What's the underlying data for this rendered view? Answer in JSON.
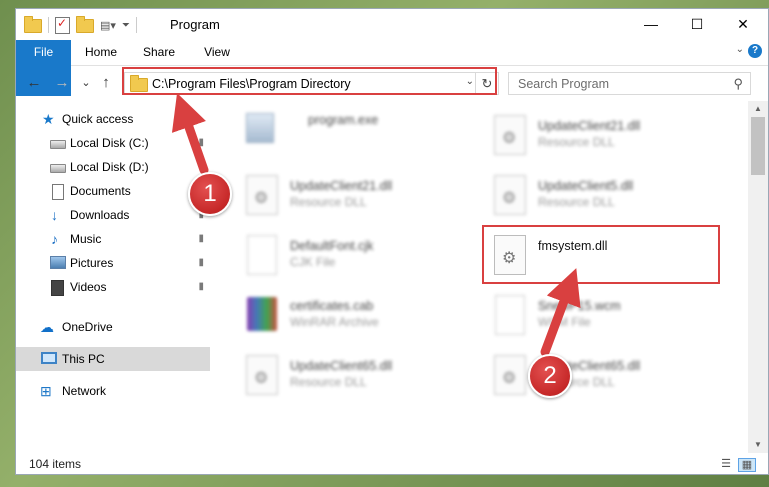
{
  "window": {
    "title": "Program",
    "minimize": "—",
    "maximize": "☐",
    "close": "✕"
  },
  "ribbon": {
    "tabs": [
      "File",
      "Home",
      "Share",
      "View"
    ]
  },
  "navigation": {
    "back": "←",
    "forward": "→",
    "recent": "⌄",
    "up": "↑",
    "address": "C:\\Program Files\\Program Directory",
    "search_placeholder": "Search Program"
  },
  "sidebar": {
    "items": [
      {
        "label": "Quick access",
        "icon": "star-icon",
        "pinned": false
      },
      {
        "label": "Local Disk (C:)",
        "icon": "drive-icon",
        "pinned": true
      },
      {
        "label": "Local Disk (D:)",
        "icon": "drive-icon",
        "pinned": false
      },
      {
        "label": "Documents",
        "icon": "documents-icon",
        "pinned": true
      },
      {
        "label": "Downloads",
        "icon": "downloads-icon",
        "pinned": true
      },
      {
        "label": "Music",
        "icon": "music-icon",
        "pinned": true
      },
      {
        "label": "Pictures",
        "icon": "pictures-icon",
        "pinned": true
      },
      {
        "label": "Videos",
        "icon": "videos-icon",
        "pinned": true
      },
      {
        "label": "OneDrive",
        "icon": "onedrive-icon",
        "pinned": false
      },
      {
        "label": "This PC",
        "icon": "this-pc-icon",
        "pinned": false,
        "selected": true
      },
      {
        "label": "Network",
        "icon": "network-icon",
        "pinned": false
      }
    ],
    "pin_glyph": "📌"
  },
  "files": [
    {
      "name": "program.exe",
      "type": "",
      "icon": "exe-icon"
    },
    {
      "name": "UpdateClient21.dll",
      "type": "Resource DLL",
      "icon": "dll-icon"
    },
    {
      "name": "UpdateClient21.dll",
      "type": "Resource DLL",
      "icon": "dll-icon"
    },
    {
      "name": "UpdateClient5.dll",
      "type": "Resource DLL",
      "icon": "dll-icon"
    },
    {
      "name": "DefaultFont.cjk",
      "type": "CJK File",
      "icon": "file-icon"
    },
    {
      "name": "fmsystem.dll",
      "type": "",
      "icon": "dll-icon",
      "highlighted": true
    },
    {
      "name": "certificates.cab",
      "type": "WinRAR Archive",
      "icon": "archive-icon"
    },
    {
      "name": "SnewP15.wcm",
      "type": "WCM File",
      "icon": "file-icon"
    },
    {
      "name": "UpdateClient65.dll",
      "type": "Resource DLL",
      "icon": "dll-icon"
    },
    {
      "name": "UpdateClient65.dll",
      "type": "Resource DLL",
      "icon": "dll-icon"
    }
  ],
  "status": {
    "item_count": "104 items"
  },
  "annotations": {
    "badge1": "1",
    "badge2": "2",
    "color": "#d94040"
  }
}
